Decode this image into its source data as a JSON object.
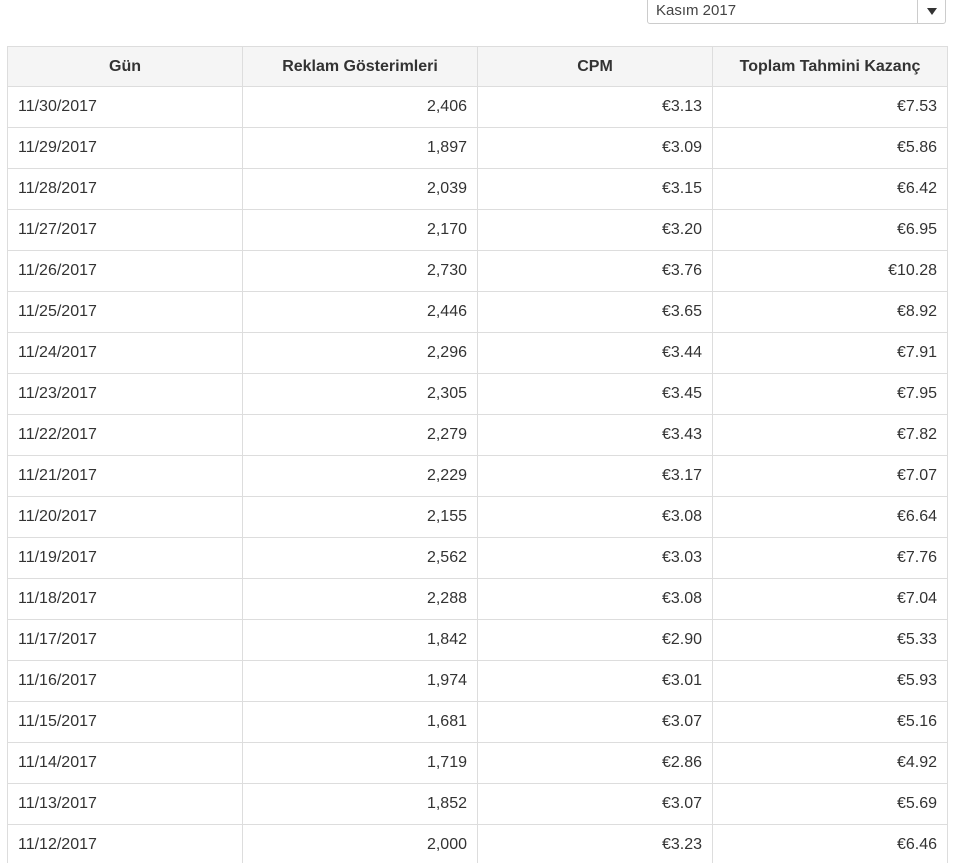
{
  "month_select": {
    "value": "Kasım 2017"
  },
  "table": {
    "headers": [
      "Gün",
      "Reklam Gösterimleri",
      "CPM",
      "Toplam Tahmini Kazanç"
    ],
    "rows": [
      [
        "11/30/2017",
        "2,406",
        "€3.13",
        "€7.53"
      ],
      [
        "11/29/2017",
        "1,897",
        "€3.09",
        "€5.86"
      ],
      [
        "11/28/2017",
        "2,039",
        "€3.15",
        "€6.42"
      ],
      [
        "11/27/2017",
        "2,170",
        "€3.20",
        "€6.95"
      ],
      [
        "11/26/2017",
        "2,730",
        "€3.76",
        "€10.28"
      ],
      [
        "11/25/2017",
        "2,446",
        "€3.65",
        "€8.92"
      ],
      [
        "11/24/2017",
        "2,296",
        "€3.44",
        "€7.91"
      ],
      [
        "11/23/2017",
        "2,305",
        "€3.45",
        "€7.95"
      ],
      [
        "11/22/2017",
        "2,279",
        "€3.43",
        "€7.82"
      ],
      [
        "11/21/2017",
        "2,229",
        "€3.17",
        "€7.07"
      ],
      [
        "11/20/2017",
        "2,155",
        "€3.08",
        "€6.64"
      ],
      [
        "11/19/2017",
        "2,562",
        "€3.03",
        "€7.76"
      ],
      [
        "11/18/2017",
        "2,288",
        "€3.08",
        "€7.04"
      ],
      [
        "11/17/2017",
        "1,842",
        "€2.90",
        "€5.33"
      ],
      [
        "11/16/2017",
        "1,974",
        "€3.01",
        "€5.93"
      ],
      [
        "11/15/2017",
        "1,681",
        "€3.07",
        "€5.16"
      ],
      [
        "11/14/2017",
        "1,719",
        "€2.86",
        "€4.92"
      ],
      [
        "11/13/2017",
        "1,852",
        "€3.07",
        "€5.69"
      ],
      [
        "11/12/2017",
        "2,000",
        "€3.23",
        "€6.46"
      ]
    ]
  }
}
